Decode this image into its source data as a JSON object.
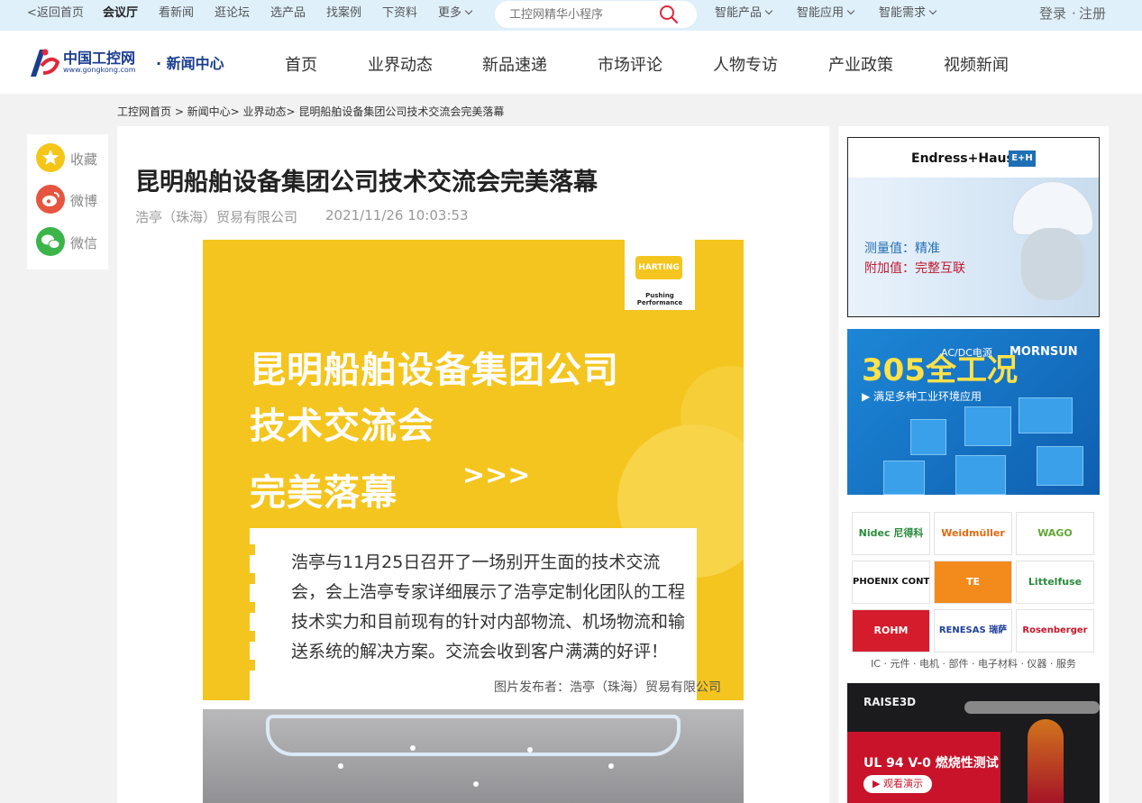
{
  "topbar": {
    "back_home": "<返回首页",
    "links": [
      {
        "label": "会议厅",
        "active": true
      },
      {
        "label": "看新闻"
      },
      {
        "label": "逛论坛"
      },
      {
        "label": "选产品"
      },
      {
        "label": "找案例"
      },
      {
        "label": "下资料"
      }
    ],
    "more": "更多",
    "search_placeholder": "工控网精华小程序",
    "menus": [
      "智能产品",
      "智能应用",
      "智能需求"
    ],
    "login": "登录",
    "sep": "·",
    "register": "注册"
  },
  "logo": {
    "cn": "中国工控网",
    "url": "www.gongkong.com",
    "section": "· 新闻中心"
  },
  "nav": [
    "首页",
    "业界动态",
    "新品速递",
    "市场评论",
    "人物专访",
    "产业政策",
    "视频新闻"
  ],
  "breadcrumb": "工控网首页 > 新闻中心> 业界动态> 昆明船舶设备集团公司技术交流会完美落幕",
  "share": [
    {
      "label": "收藏",
      "color": "#f5c518",
      "icon": "star-icon"
    },
    {
      "label": "微博",
      "color": "#e6553f",
      "icon": "weibo-icon"
    },
    {
      "label": "微信",
      "color": "#3bb54a",
      "icon": "wechat-icon"
    }
  ],
  "article": {
    "title": "昆明船舶设备集团公司技术交流会完美落幕",
    "author": "浩亭（珠海）贸易有限公司",
    "time": "2021/11/26 10:03:53",
    "poster": {
      "brand": "HARTING",
      "slogan": "Pushing Performance",
      "lines": [
        "昆明船舶设备集团公司",
        "技术交流会",
        "完美落幕"
      ],
      "arrows": ">>>",
      "body": "浩亭与11月25日召开了一场别开生面的技术交流会，会上浩亭专家详细展示了浩亭定制化团队的工程技术实力和目前现有的针对内部物流、机场物流和输送系统的解决方案。交流会收到客户满满的好评！"
    },
    "publisher": "图片发布者：浩亭（珠海）贸易有限公司"
  },
  "ads": {
    "eh": {
      "brand": "Endress+Hauser",
      "logo": "E+H",
      "line1": "测量值：精准",
      "line2": "附加值：完整互联"
    },
    "mornsun": {
      "big": "305全工况",
      "small": "AC/DC电源",
      "brand": "MORNSUN",
      "sub": "▶ 满足多种工业环境应用"
    },
    "brands": [
      "Nidec 尼得科",
      "Weidmüller",
      "WAGO",
      "PHOENIX CONTACT",
      "TE",
      "Littelfuse",
      "ROHM",
      "RENESAS 瑞萨",
      "Rosenberger"
    ],
    "brand_caption": "IC · 元件 · 电机 · 部件 · 电子材料 · 仪器 · 服务",
    "raise3d": {
      "brand": "RAISE3D",
      "title": "UL 94 V-0 燃烧性测试",
      "button": "▶ 观看演示"
    }
  },
  "colors": {
    "accent": "#1a3d8f",
    "topbar": "#dff0fb",
    "poster": "#f4c51e"
  }
}
